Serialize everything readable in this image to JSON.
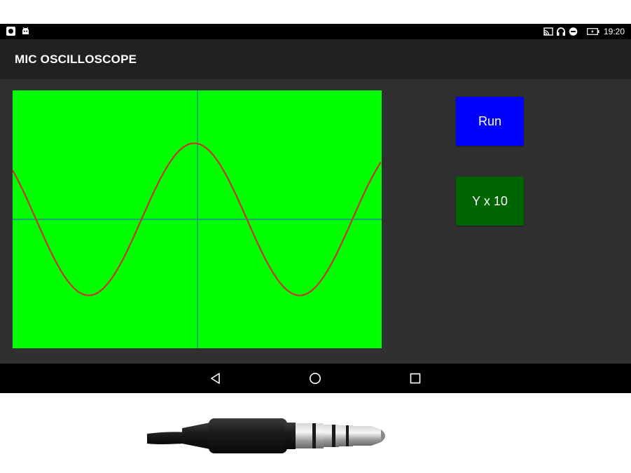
{
  "status_bar": {
    "time": "19:20",
    "left_icons": [
      "screen-record-icon",
      "android-bot-icon"
    ],
    "right_icons": [
      "cast-icon",
      "headset-icon",
      "do-not-disturb-icon",
      "battery-charging-icon"
    ]
  },
  "app_bar": {
    "title": "MIC OSCILLOSCOPE"
  },
  "scope": {
    "screen_color": "#00ff00",
    "trace_color": "#c0392b",
    "axis_color": "#2e6db4",
    "waveform": "sine",
    "cycles_visible": 1.75,
    "amplitude_fraction": 0.59,
    "start_phase_deg": 140
  },
  "controls": {
    "run_label": "Run",
    "run_color": "#0000ff",
    "ymult_label": "Y x 10",
    "ymult_color": "#006400"
  },
  "nav_bar": {
    "buttons": [
      "back-icon",
      "home-icon",
      "recents-icon"
    ]
  },
  "below_screen_image": "audio-jack-plug-photo"
}
